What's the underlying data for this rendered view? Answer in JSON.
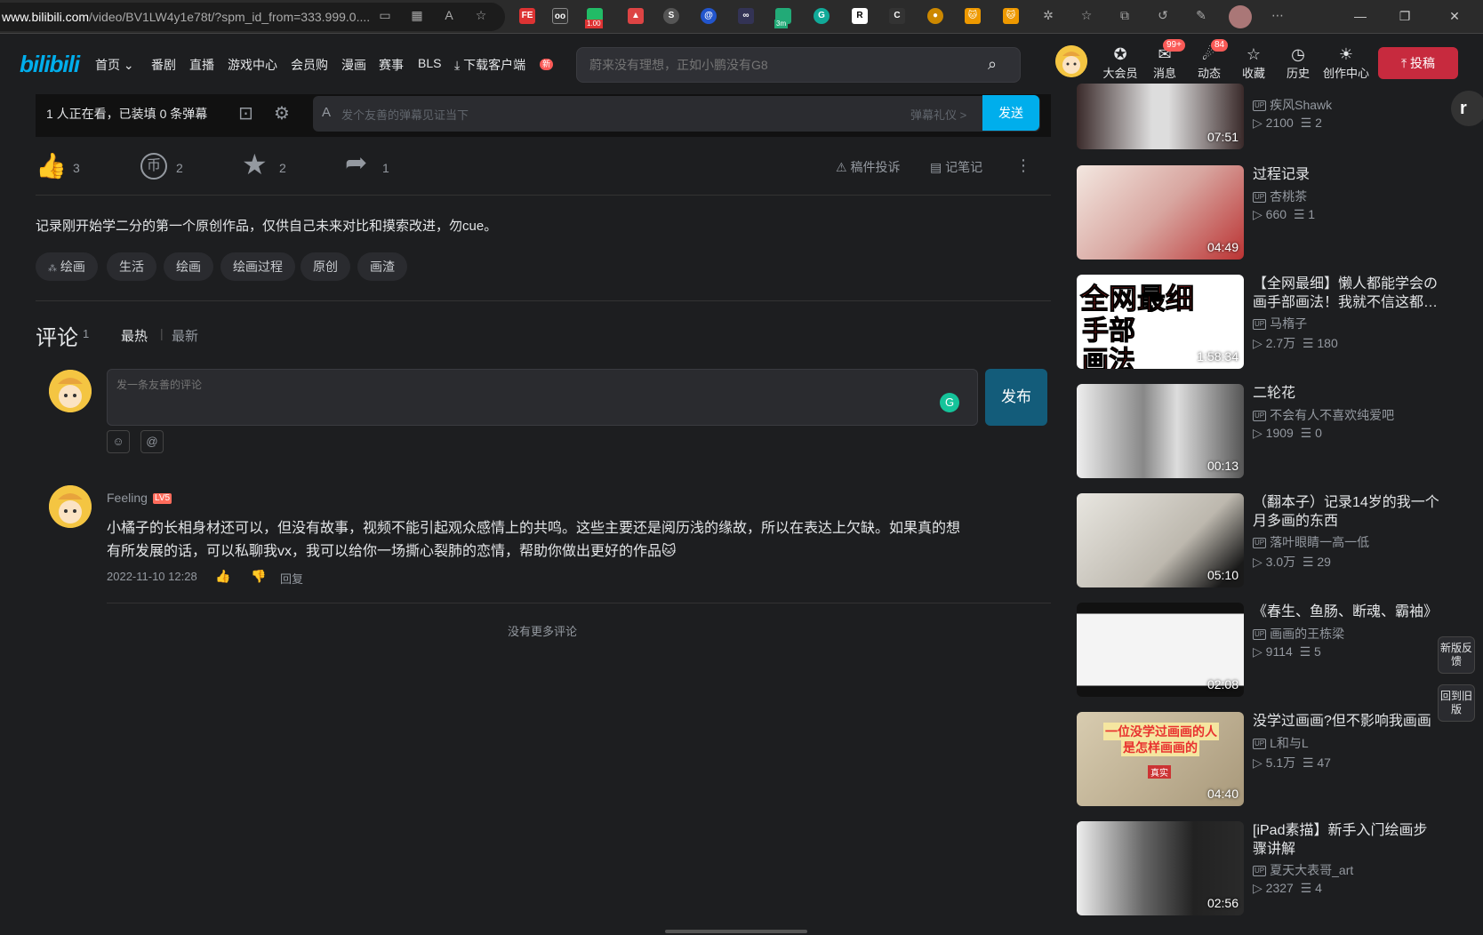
{
  "browser": {
    "url_host": "www.bilibili.com",
    "url_path": "/video/BV1LW4y1e78t/?spm_id_from=333.999.0....",
    "ext_badge": "1.00",
    "ext_badge2": "3m"
  },
  "header": {
    "logo": "bilibili",
    "nav": [
      "首页",
      "番剧",
      "直播",
      "游戏中心",
      "会员购",
      "漫画",
      "赛事",
      "BLS",
      "下载客户端"
    ],
    "new_badge": "新",
    "search_placeholder": "蔚来没有理想，正如小鹏没有G8",
    "right_items": [
      "大会员",
      "消息",
      "动态",
      "收藏",
      "历史",
      "创作中心"
    ],
    "msg_badge": "99+",
    "dyn_badge": "84",
    "upload_label": "投稿"
  },
  "danmaku": {
    "viewers": "1 人正在看，已装填 0 条弹幕",
    "placeholder": "发个友善的弹幕见证当下",
    "etiquette": "弹幕礼仪 >",
    "send_label": "发送"
  },
  "actions": {
    "like": "3",
    "coin": "2",
    "fav": "2",
    "share": "1",
    "report": "稿件投诉",
    "notes": "记笔记"
  },
  "description": "记录刚开始学二分的第一个原创作品，仅供自己未来对比和摸索改进，勿cue。",
  "tags": [
    "绘画",
    "生活",
    "绘画",
    "绘画过程",
    "原创",
    "画渣"
  ],
  "comments": {
    "title": "评论",
    "count": "1",
    "sort_hot": "最热",
    "sort_new": "最新",
    "input_placeholder": "发一条友善的评论",
    "publish": "发布",
    "emoji_btn": "☺",
    "at_btn": "@",
    "items": [
      {
        "user": "Feeling",
        "level": "LV5",
        "text": "小橘子的长相身材还可以，但没有故事，视频不能引起观众感情上的共鸣。这些主要还是阅历浅的缘故，所以在表达上欠缺。如果真的想有所发展的话，可以私聊我vx，我可以给你一场撕心裂肺的恋情，帮助你做出更好的作品🐱",
        "time": "2022-11-10 12:28",
        "reply": "回复"
      }
    ],
    "no_more": "没有更多评论"
  },
  "related": [
    {
      "title": "",
      "up": "疾风Shawk",
      "views": "2100",
      "danmaku": "2",
      "duration": "07:51",
      "color": "#8a8a8a"
    },
    {
      "title": "过程记录",
      "up": "杏桃茶",
      "views": "660",
      "danmaku": "1",
      "duration": "04:49",
      "color": "#d8a6a0"
    },
    {
      "title": "【全网最细】懒人都能学会の画手部画法！我就不信这都…",
      "up": "马楕子",
      "views": "2.7万",
      "danmaku": "180",
      "duration": "1:58:34",
      "color": "#e6c070"
    },
    {
      "title": "二轮花",
      "up": "不会有人不喜欢纯爱吧",
      "views": "1909",
      "danmaku": "0",
      "duration": "00:13",
      "color": "#bdbdbd"
    },
    {
      "title": "（翻本子）记录14岁的我一个月多画的东西",
      "up": "落叶眼睛一高一低",
      "views": "3.0万",
      "danmaku": "29",
      "duration": "05:10",
      "color": "#c8c4bd"
    },
    {
      "title": "《春生、鱼肠、断魂、霸袖》",
      "up": "画画的王栋梁",
      "views": "9114",
      "danmaku": "5",
      "duration": "02:08",
      "color": "#e8e8e8"
    },
    {
      "title": "没学过画画?但不影响我画画",
      "up": "L和与L",
      "views": "5.1万",
      "danmaku": "47",
      "duration": "04:40",
      "color": "#c9b89a"
    },
    {
      "title": "[iPad素描】新手入门绘画步骤讲解",
      "up": "夏天大表哥_art",
      "views": "2327",
      "danmaku": "4",
      "duration": "02:56",
      "color": "#6a6a6a"
    }
  ],
  "thumb_texts": {
    "t3a": "全网最细",
    "t3b": "手部",
    "t3c": "画法",
    "t7a": "一位没学过画画的人",
    "t7b": "是怎样画画的",
    "t7c": "真实"
  },
  "side_buttons": [
    "新版反馈",
    "回到旧版"
  ]
}
